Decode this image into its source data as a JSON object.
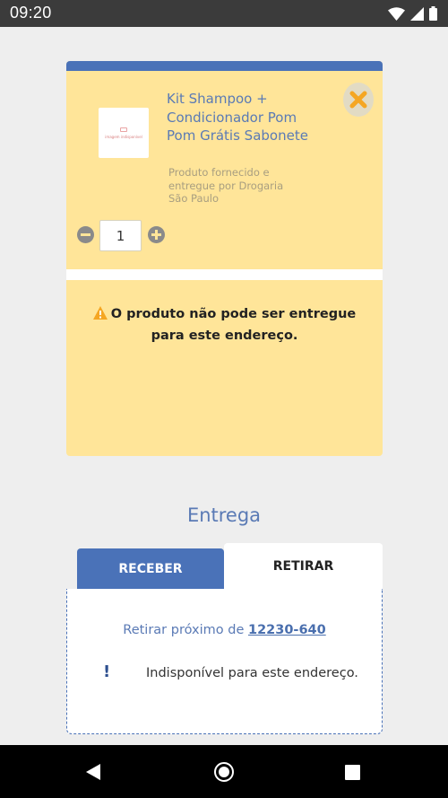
{
  "status_bar": {
    "time": "09:20",
    "icons": [
      "wifi-icon",
      "signal-icon",
      "battery-icon"
    ]
  },
  "cart_item": {
    "image_placeholder": "imagem indisponível",
    "title": "Kit Shampoo + Condicionador Pom Pom Grátis Sabonete",
    "seller": "Produto fornecido e entregue por Drogaria São Paulo",
    "quantity": "1",
    "remove_icon": "close-icon",
    "warning": "O produto não pode ser entregue para este endereço."
  },
  "delivery": {
    "heading": "Entrega",
    "tabs": [
      {
        "label": "RECEBER",
        "active": true
      },
      {
        "label": "RETIRAR",
        "active": false
      }
    ],
    "pickup_prefix": "Retirar próximo de",
    "pickup_cep": "12230-640",
    "unavailable_icon": "exclamation-icon",
    "unavailable_text": "Indisponível para este endereço."
  },
  "colors": {
    "accent_blue": "#4a72b8",
    "card_yellow": "#ffe599",
    "remove_orange": "#f5a623",
    "warning_orange": "#f5a623"
  },
  "nav_bar": {
    "buttons": [
      "back-icon",
      "home-icon",
      "recent-apps-icon"
    ]
  }
}
